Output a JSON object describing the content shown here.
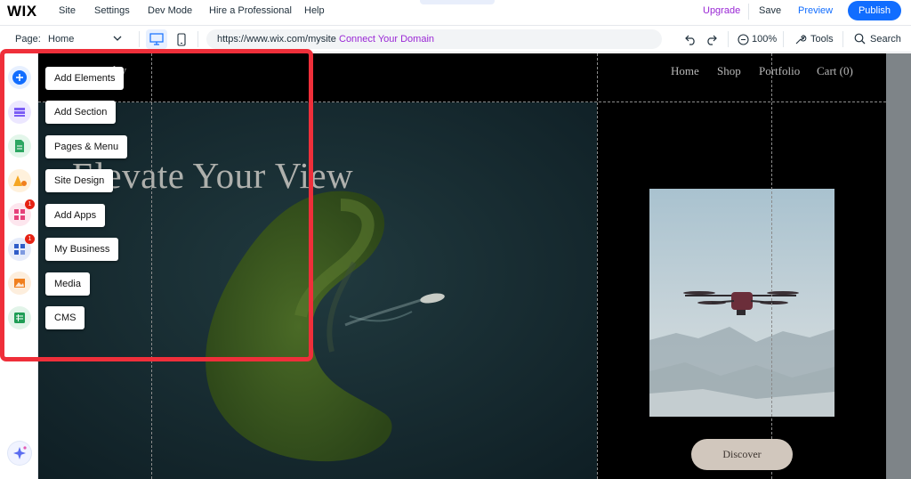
{
  "topbar": {
    "logo": "WIX",
    "menu": [
      "Site",
      "Settings",
      "Dev Mode",
      "Hire a Professional",
      "Help"
    ],
    "upgrade": "Upgrade",
    "save": "Save",
    "preview": "Preview",
    "publish": "Publish"
  },
  "toolbar": {
    "page_label": "Page:",
    "page_value": "Home",
    "url": "https://www.wix.com/mysite",
    "connect_domain": "Connect Your Domain",
    "zoom": "100%",
    "tools": "Tools",
    "search": "Search"
  },
  "rail": {
    "items": [
      {
        "icon": "plus-icon",
        "color": "#116dff"
      },
      {
        "icon": "sections-icon",
        "color": "#7a5cf5"
      },
      {
        "icon": "pages-icon",
        "color": "#2da662"
      },
      {
        "icon": "design-icon",
        "color": "#f5a623"
      },
      {
        "icon": "apps-icon",
        "color": "#e6407a",
        "badge": "1"
      },
      {
        "icon": "business-icon",
        "color": "#2f5dc8",
        "badge": "1"
      },
      {
        "icon": "media-icon",
        "color": "#f07f1e"
      },
      {
        "icon": "cms-icon",
        "color": "#1f9d55"
      }
    ],
    "labels": [
      "Add Elements",
      "Add Section",
      "Pages & Menu",
      "Site Design",
      "Add Apps",
      "My Business",
      "Media",
      "CMS"
    ]
  },
  "site": {
    "logo_text": "otography",
    "nav": [
      "Home",
      "Shop",
      "Portfolio",
      "Cart (0)"
    ],
    "hero_title": "Elevate Your View",
    "discover": "Discover"
  },
  "colors": {
    "accent": "#116dff",
    "upgrade": "#9a27d5",
    "highlight": "#ef2f3a"
  }
}
